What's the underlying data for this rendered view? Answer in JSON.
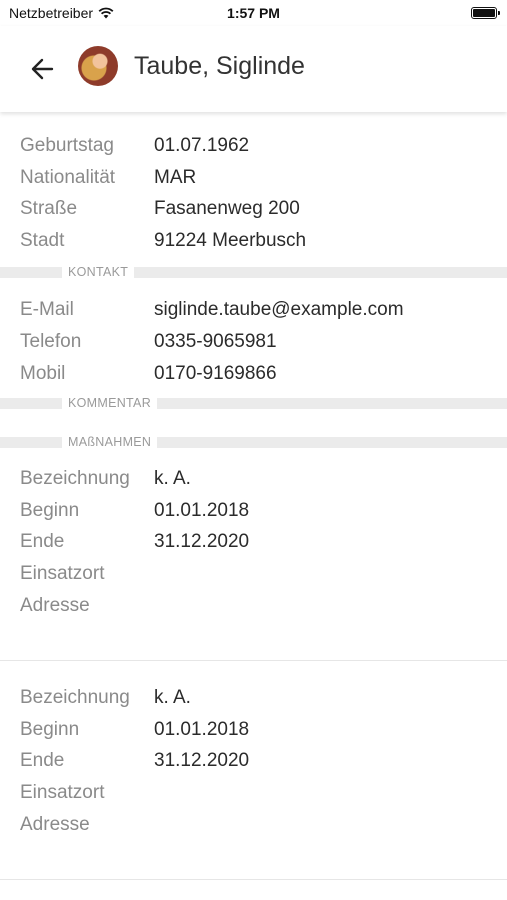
{
  "status": {
    "carrier": "Netzbetreiber",
    "time": "1:57 PM"
  },
  "header": {
    "title": "Taube, Siglinde"
  },
  "personal": [
    {
      "label": "Geburtstag",
      "value": "01.07.1962"
    },
    {
      "label": "Nationalität",
      "value": "MAR"
    },
    {
      "label": "Straße",
      "value": "Fasanenweg 200"
    },
    {
      "label": "Stadt",
      "value": "91224 Meerbusch"
    }
  ],
  "sections": {
    "contact": "KONTAKT",
    "comment": "KOMMENTAR",
    "measures": "MAßNAHMEN"
  },
  "contact": [
    {
      "label": "E-Mail",
      "value": "siglinde.taube@example.com"
    },
    {
      "label": "Telefon",
      "value": "0335-9065981"
    },
    {
      "label": "Mobil",
      "value": "0170-9169866"
    }
  ],
  "measures": [
    {
      "rows": [
        {
          "label": "Bezeichnung",
          "value": "k. A."
        },
        {
          "label": "Beginn",
          "value": "01.01.2018"
        },
        {
          "label": "Ende",
          "value": "31.12.2020"
        },
        {
          "label": "Einsatzort",
          "value": ""
        },
        {
          "label": "Adresse",
          "value": ""
        }
      ]
    },
    {
      "rows": [
        {
          "label": "Bezeichnung",
          "value": "k. A."
        },
        {
          "label": "Beginn",
          "value": "01.01.2018"
        },
        {
          "label": "Ende",
          "value": "31.12.2020"
        },
        {
          "label": "Einsatzort",
          "value": ""
        },
        {
          "label": "Adresse",
          "value": ""
        }
      ]
    }
  ]
}
